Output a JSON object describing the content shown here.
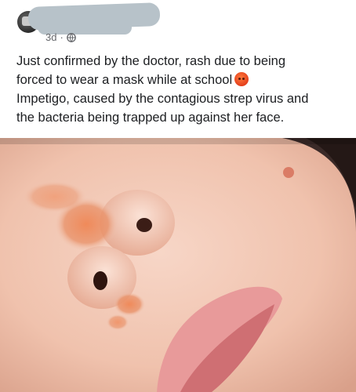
{
  "post": {
    "time": "3d",
    "separator": "·",
    "audience_icon": "globe-icon",
    "text_lines": [
      "Just confirmed by the doctor, rash due to being",
      "forced to wear a mask while at school",
      "Impetigo, caused by the contagious strep virus and",
      "the bacteria being trapped up against her face."
    ],
    "emoji": "angry-face-emoji"
  },
  "colors": {
    "text": "#1c1e21",
    "meta": "#65676b",
    "redaction": "#b7c2c9",
    "skin": "#f2c8b5",
    "rash": "#e8875e"
  }
}
